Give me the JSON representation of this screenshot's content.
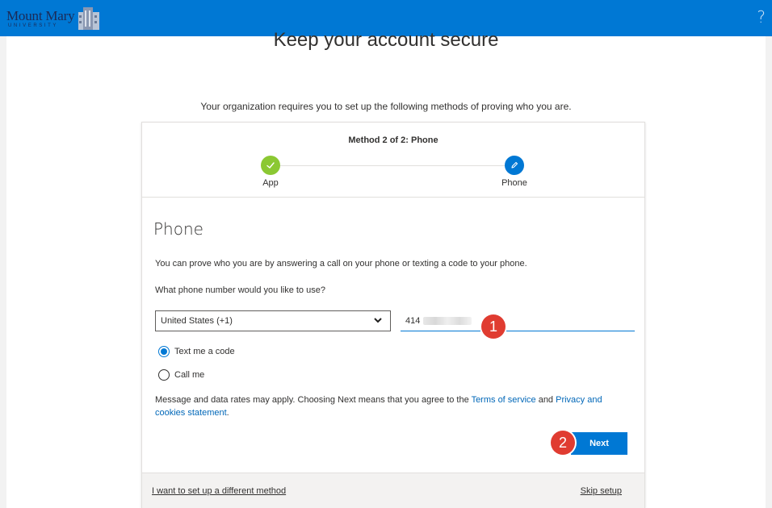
{
  "header": {
    "logo_main": "Mount Mary",
    "logo_sub": "UNIVERSITY",
    "help_label": "?",
    "brand_color": "#0078d4"
  },
  "page": {
    "title": "Keep your account secure",
    "subtitle": "Your organization requires you to set up the following methods of proving who you are."
  },
  "wizard": {
    "method_label": "Method 2 of 2: Phone",
    "steps": [
      {
        "label": "App",
        "status": "complete",
        "icon": "check-icon",
        "color": "#8bc833"
      },
      {
        "label": "Phone",
        "status": "current",
        "icon": "pencil-icon",
        "color": "#0078d4"
      }
    ]
  },
  "phone_section": {
    "title": "Phone",
    "description": "You can prove who you are by answering a call on your phone or texting a code to your phone.",
    "question": "What phone number would you like to use?",
    "country_select": {
      "value": "United States (+1)"
    },
    "phone_input": {
      "value": "414"
    },
    "options": [
      {
        "label": "Text me a code",
        "checked": true
      },
      {
        "label": "Call me",
        "checked": false
      }
    ],
    "notice_prefix": "Message and data rates may apply. Choosing Next means that you agree to the ",
    "terms_link": "Terms of service",
    "notice_and": " and ",
    "privacy_link": "Privacy and cookies statement",
    "notice_suffix": ".",
    "next_label": "Next"
  },
  "annotations": [
    {
      "label": "1",
      "color": "#e03c31"
    },
    {
      "label": "2",
      "color": "#e03c31"
    }
  ],
  "footer": {
    "different_method": "I want to set up a different method",
    "skip": "Skip setup"
  }
}
